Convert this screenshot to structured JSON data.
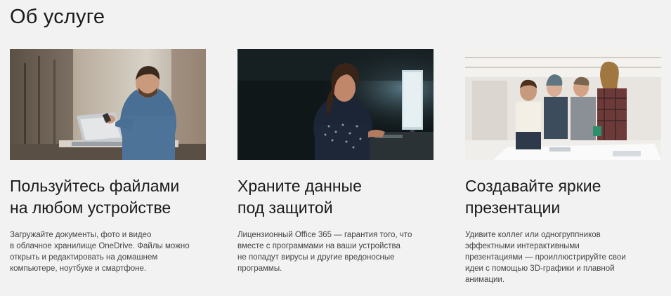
{
  "section": {
    "title": "Об услуге"
  },
  "cards": [
    {
      "heading": "Пользуйтесь файлами\nна любом устройстве",
      "text": "Загружайте документы, фото и видео\nв облачное хранилище OneDrive. Файлы можно\nоткрыть и редактировать на домашнем\nкомпьютере, ноутбуке и смартфоне."
    },
    {
      "heading": "Храните данные\nпод защитой",
      "text": "Лицензионный Office 365 — гарантия того, что\nвместе с программами на ваши устройства\nне попадут вирусы и другие вредоносные\nпрограммы."
    },
    {
      "heading": "Создавайте яркие\nпрезентации",
      "text": "Удивите коллег или одногруппников\nэффектными интерактивными\nпрезентациями — проиллюстрируйте свои\nидеи с помощью 3D-графики и плавной\nанимации."
    }
  ]
}
